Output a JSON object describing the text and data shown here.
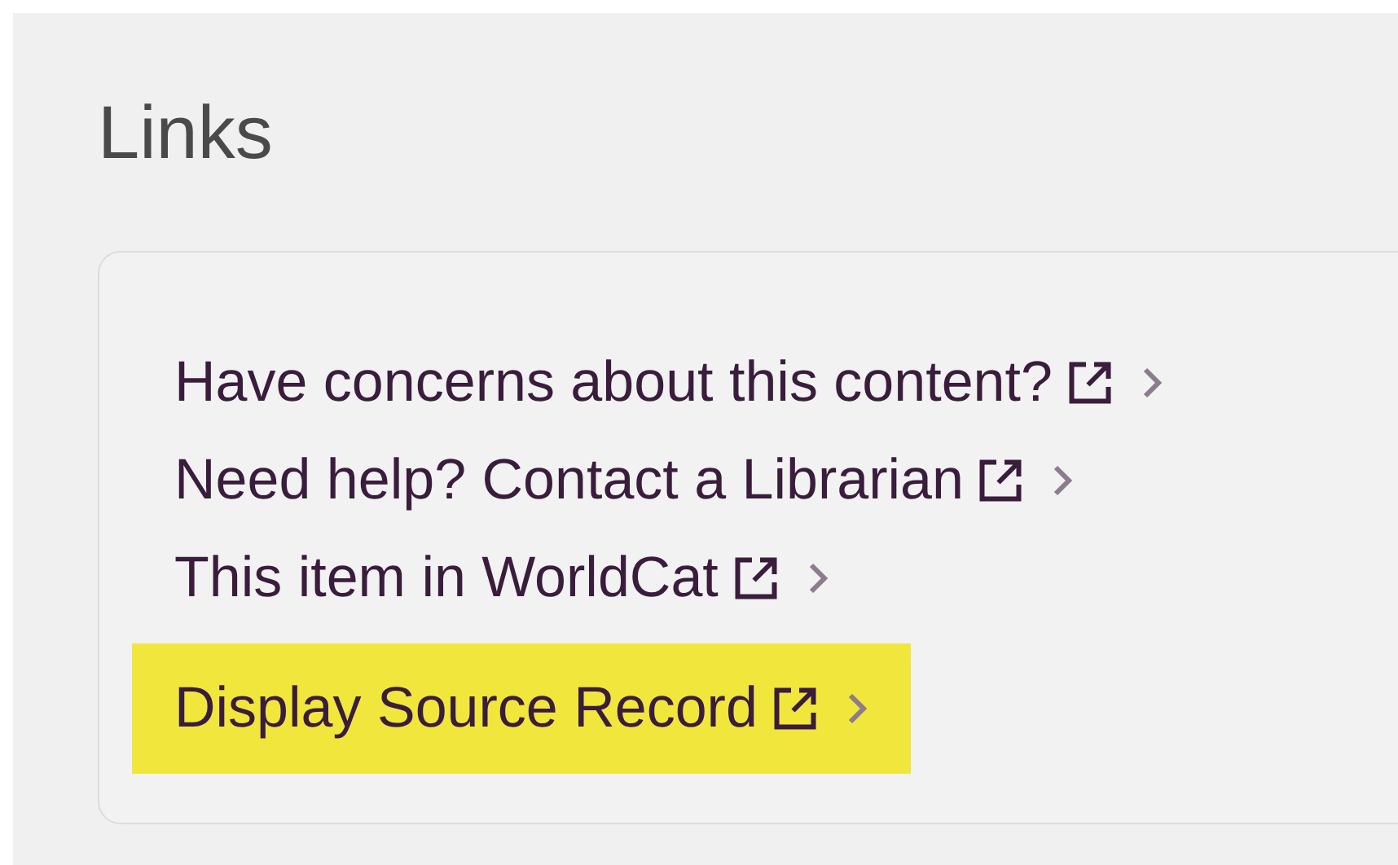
{
  "heading": "Links",
  "links": [
    {
      "label": "Have concerns about this content?",
      "highlighted": false
    },
    {
      "label": "Need help? Contact a Librarian",
      "highlighted": false
    },
    {
      "label": "This item in WorldCat",
      "highlighted": false
    },
    {
      "label": "Display Source Record",
      "highlighted": true
    }
  ]
}
